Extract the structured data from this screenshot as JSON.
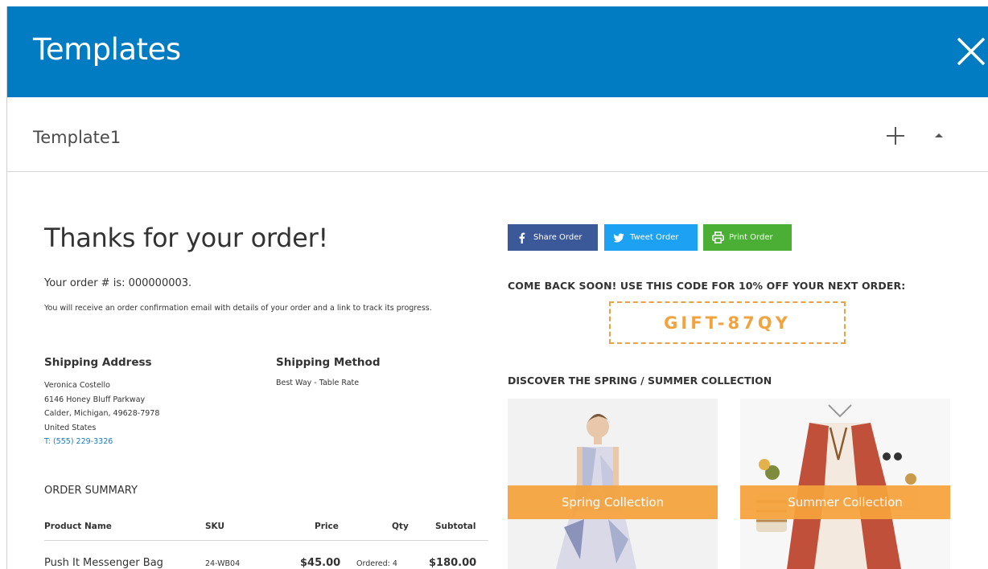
{
  "header": {
    "title": "Templates",
    "close_icon": "close-icon"
  },
  "template_bar": {
    "name": "Template1",
    "add_icon": "plus-icon",
    "collapse_icon": "caret-up-icon"
  },
  "order": {
    "heading": "Thanks for your order!",
    "order_number_text": "Your order # is: 000000003.",
    "confirmation_text": "You will receive an order confirmation email with details of your order and a link to track its progress.",
    "shipping_address": {
      "label": "Shipping Address",
      "name": "Veronica Costello",
      "street": "6146 Honey Bluff Parkway",
      "city_line": "Calder, Michigan, 49628-7978",
      "country": "United States",
      "phone": "T: (555) 229-3326"
    },
    "shipping_method": {
      "label": "Shipping Method",
      "value": "Best Way - Table Rate"
    },
    "summary": {
      "title": "ORDER SUMMARY",
      "columns": [
        "Product Name",
        "SKU",
        "Price",
        "Qty",
        "Subtotal"
      ],
      "rows": [
        {
          "product": "Push It Messenger Bag",
          "sku": "24-WB04",
          "price": "$45.00",
          "qty": "Ordered: 4",
          "subtotal": "$180.00"
        }
      ]
    }
  },
  "social": {
    "share_label": "Share Order",
    "tweet_label": "Tweet Order",
    "print_label": "Print Order",
    "colors": {
      "facebook": "#3b5998",
      "twitter": "#1da1f2",
      "print": "#4caf35"
    }
  },
  "promo": {
    "comeback_text": "COME BACK SOON! USE THIS CODE FOR 10% OFF YOUR NEXT ORDER:",
    "code": "GIFT-87QY",
    "discover_text": "DISCOVER THE SPRING / SUMMER COLLECTION",
    "collections": [
      {
        "label": "Spring Collection"
      },
      {
        "label": "Summer Collection"
      }
    ]
  },
  "theme": {
    "header_bg": "#017bc1",
    "accent_orange": "#f6a33c",
    "link_blue": "#1979c3"
  }
}
